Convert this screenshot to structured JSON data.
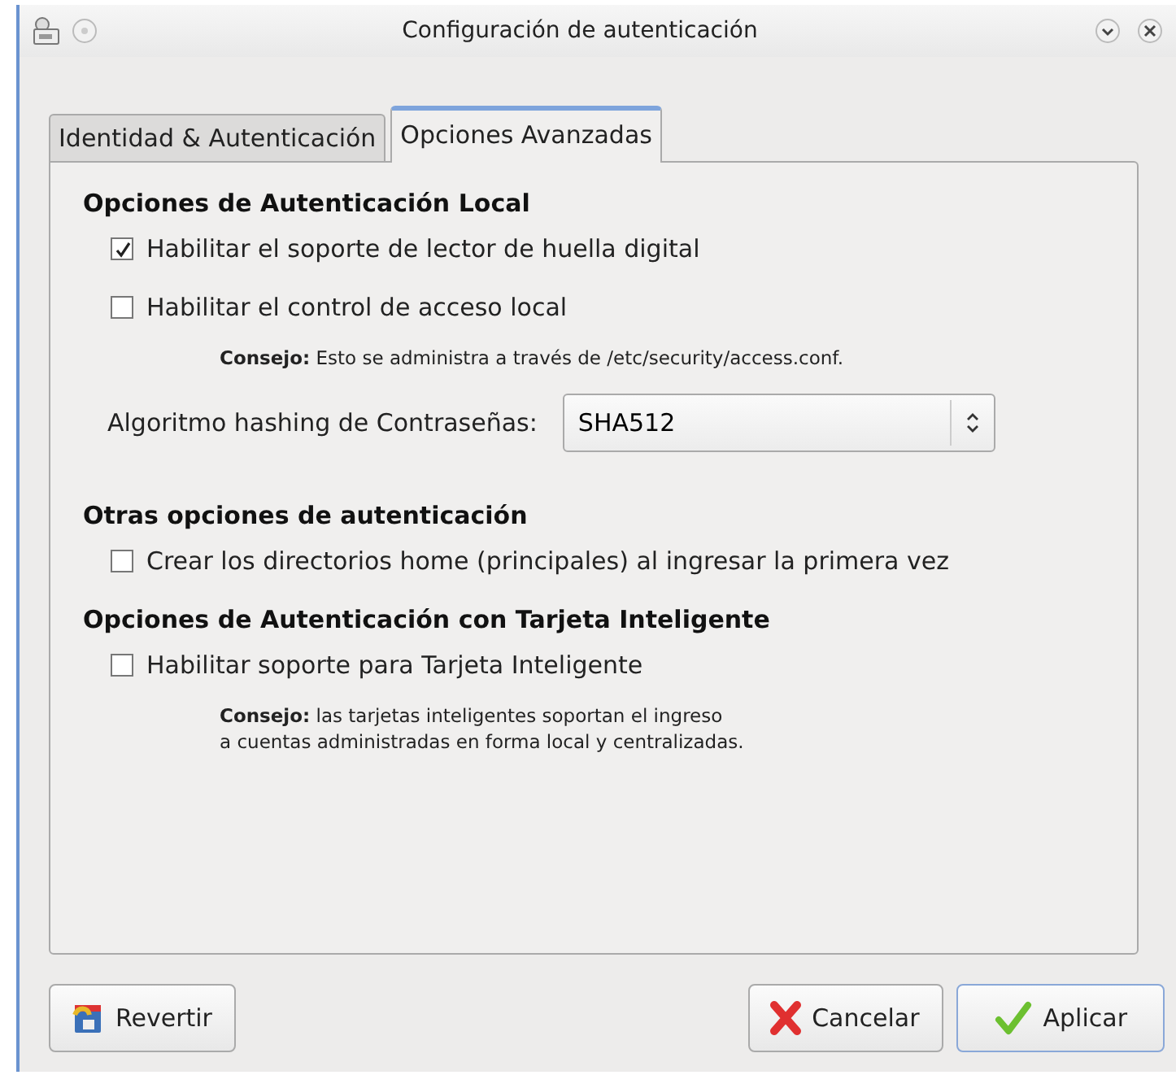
{
  "window": {
    "title": "Configuración de autenticación"
  },
  "tabs": [
    {
      "label": "Identidad & Autenticación",
      "selected": false
    },
    {
      "label": "Opciones Avanzadas",
      "selected": true
    }
  ],
  "sections": [
    {
      "heading": "Opciones de Autenticación Local",
      "items": [
        {
          "kind": "checkbox",
          "label": "Habilitar el soporte de lector de huella digital",
          "checked": true
        },
        {
          "kind": "checkbox",
          "label": "Habilitar el control de acceso local",
          "checked": false
        },
        {
          "kind": "tip",
          "text": "**Consejo:** Esto se administra a través de /etc/security/access.conf."
        },
        {
          "kind": "select",
          "label": "Algoritmo hashing de Contraseñas:",
          "value": "SHA512"
        }
      ]
    },
    {
      "heading": "Otras opciones de autenticación",
      "items": [
        {
          "kind": "checkbox",
          "label": "Crear los directorios home (principales) al ingresar la primera vez",
          "checked": false
        }
      ]
    },
    {
      "heading": "Opciones de Autenticación con Tarjeta Inteligente",
      "items": [
        {
          "kind": "checkbox",
          "label": "Habilitar soporte para Tarjeta Inteligente",
          "checked": false
        },
        {
          "kind": "tip",
          "text": "**Consejo:** las tarjetas inteligentes soportan el ingreso\na cuentas administradas en forma local y centralizadas."
        }
      ]
    }
  ],
  "buttons": [
    {
      "kind": "revert",
      "label": "Revertir"
    },
    {
      "kind": "cancel",
      "label": "Cancelar"
    },
    {
      "kind": "apply",
      "label": "Aplicar"
    }
  ]
}
